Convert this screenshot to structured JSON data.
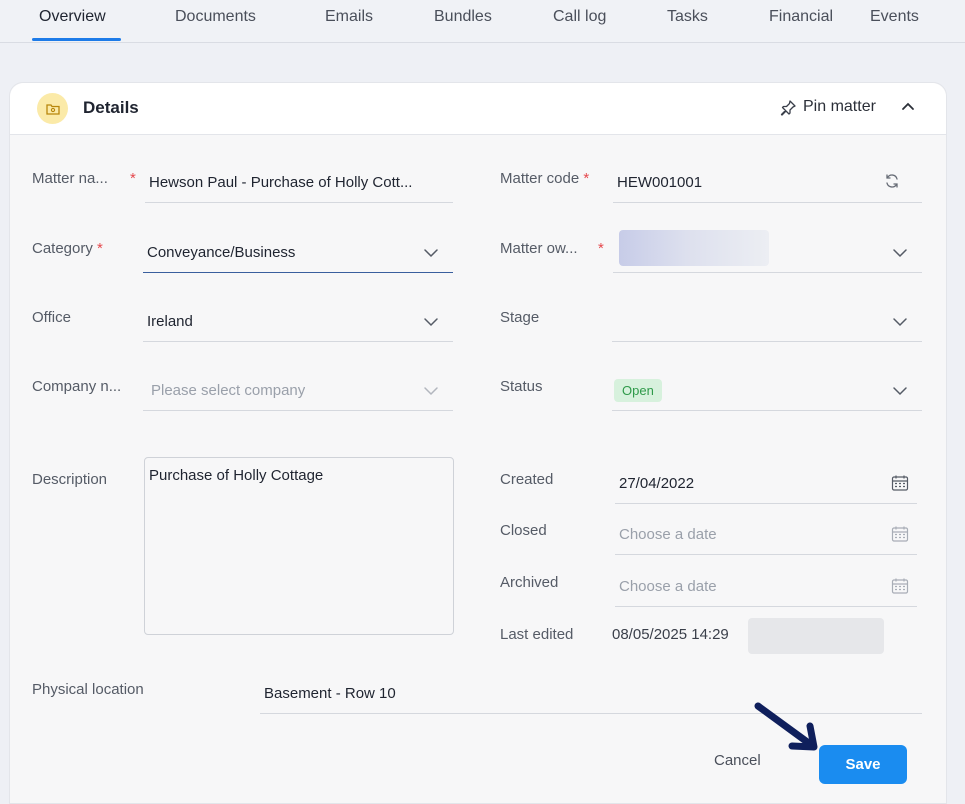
{
  "tabs": [
    {
      "label": "Overview",
      "active": true
    },
    {
      "label": "Documents"
    },
    {
      "label": "Emails"
    },
    {
      "label": "Bundles"
    },
    {
      "label": "Call log"
    },
    {
      "label": "Tasks"
    },
    {
      "label": "Financial"
    },
    {
      "label": "Events"
    }
  ],
  "details": {
    "title": "Details",
    "icon": "folder-icon",
    "pin_label": "Pin matter",
    "collapse_icon": "chevron-up-icon"
  },
  "form": {
    "matter_name": {
      "label": "Matter na...",
      "required_mark": "*",
      "value": "Hewson Paul - Purchase of Holly Cott..."
    },
    "matter_code": {
      "label": "Matter code",
      "required_mark": "*",
      "value": "HEW001001"
    },
    "category": {
      "label": "Category",
      "required_mark": "*",
      "value": "Conveyance/Business"
    },
    "matter_owner": {
      "label": "Matter ow...",
      "required_mark": "*"
    },
    "office": {
      "label": "Office",
      "value": "Ireland"
    },
    "stage": {
      "label": "Stage",
      "value": ""
    },
    "company": {
      "label": "Company n...",
      "placeholder": "Please select company"
    },
    "status": {
      "label": "Status",
      "value": "Open"
    },
    "description": {
      "label": "Description",
      "value": "Purchase of Holly Cottage"
    },
    "created": {
      "label": "Created",
      "value": "27/04/2022"
    },
    "closed": {
      "label": "Closed",
      "placeholder": "Choose a date"
    },
    "archived": {
      "label": "Archived",
      "placeholder": "Choose a date"
    },
    "last_edited": {
      "label": "Last edited",
      "value": "08/05/2025 14:29"
    },
    "physical_location": {
      "label": "Physical location",
      "value": "Basement - Row 10"
    }
  },
  "actions": {
    "cancel_label": "Cancel",
    "save_label": "Save"
  },
  "colors": {
    "accent": "#1d7be8",
    "save_button": "#1a8cf0",
    "status_open_bg": "#d7f1dd",
    "status_open_text": "#2f9a4a",
    "required": "#e5484d"
  }
}
